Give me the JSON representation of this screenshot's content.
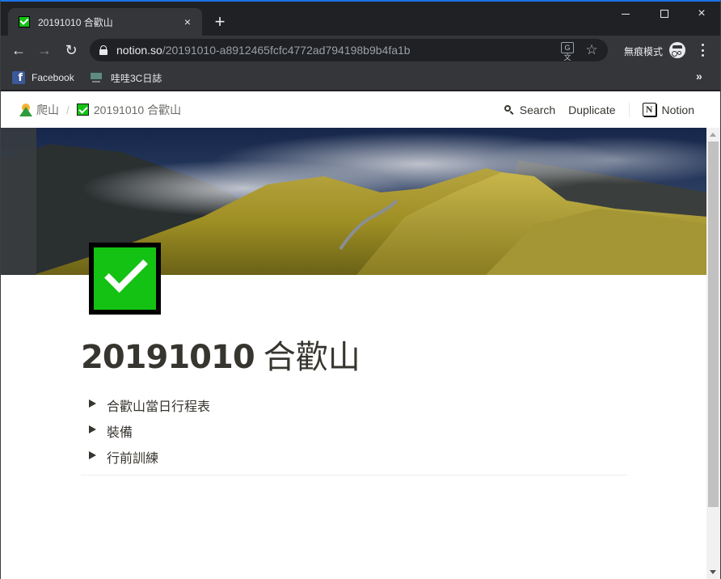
{
  "browser": {
    "tab": {
      "title": "20191010 合歡山",
      "close": "×"
    },
    "new_tab": "+",
    "window_controls": {
      "minimize": "minimize",
      "maximize": "maximize",
      "close": "×"
    },
    "nav": {
      "back": "←",
      "forward": "→",
      "reload": "↻"
    },
    "address": {
      "host": "notion.so",
      "path": "/20191010-a8912465fcfc4772ad794198b9b4fa1b"
    },
    "omnibox_icons": {
      "translate": "G文",
      "bookmark_star": "☆"
    },
    "incognito_label": "無痕模式",
    "bookmarks": [
      {
        "label": "Facebook",
        "icon": "facebook-icon"
      },
      {
        "label": "哇哇3C日誌",
        "icon": "monitor-icon"
      }
    ],
    "bookmarks_more": "»"
  },
  "notion": {
    "breadcrumb": [
      {
        "label": "爬山",
        "icon": "mountain-sunrise-icon"
      },
      {
        "label": "20191010 合歡山",
        "icon": "check-box-icon"
      }
    ],
    "breadcrumb_separator": "/",
    "actions": {
      "search": "Search",
      "duplicate": "Duplicate",
      "notion": "Notion",
      "notion_logo": "N"
    },
    "page": {
      "title_number": "20191010",
      "title_text": "合歡山",
      "toggles": [
        {
          "label": "合歡山當日行程表"
        },
        {
          "label": "裝備"
        },
        {
          "label": "行前訓練"
        }
      ]
    }
  },
  "colors": {
    "accent_green": "#14c214",
    "text": "#37352f",
    "chrome_dark": "#202124",
    "chrome_toolbar": "#35363a"
  }
}
